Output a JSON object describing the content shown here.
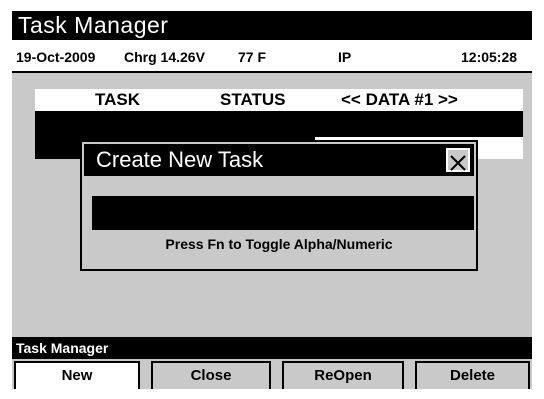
{
  "app": {
    "title": "Task Manager"
  },
  "status": {
    "date": "19-Oct-2009",
    "charge": "Chrg 14.26V",
    "temperature": "77 F",
    "mode": "IP",
    "time": "12:05:28"
  },
  "table": {
    "columns": [
      "TASK",
      "STATUS",
      "<< DATA #1 >>"
    ]
  },
  "dialog": {
    "title": "Create New Task",
    "input_value": "",
    "hint": "Press Fn to Toggle Alpha/Numeric",
    "close_icon": "close-x-icon"
  },
  "footer": {
    "label": "Task Manager",
    "buttons": [
      "New",
      "Close",
      "ReOpen",
      "Delete"
    ]
  }
}
